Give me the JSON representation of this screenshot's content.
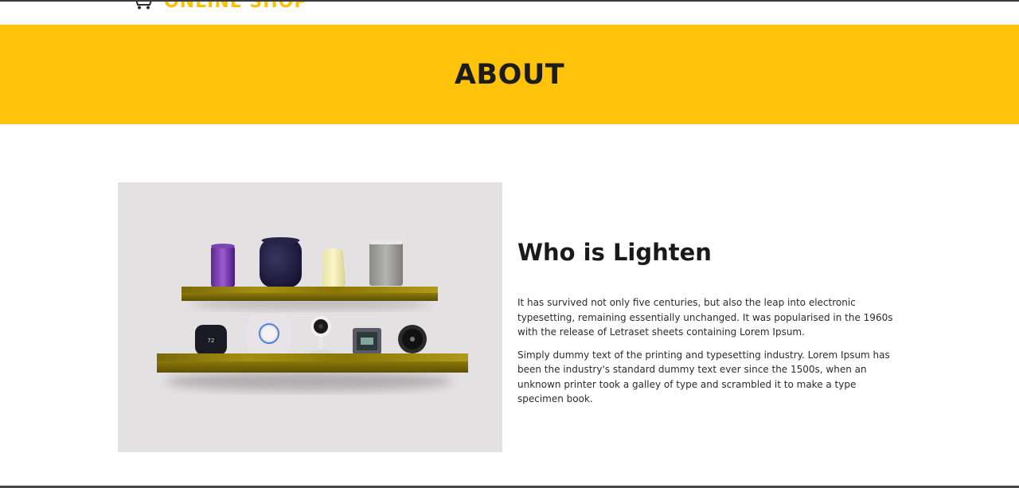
{
  "header": {
    "brand_name": "ONLINE SHOP",
    "brand_icon": "cart-icon"
  },
  "banner": {
    "title": "ABOUT"
  },
  "about": {
    "image_alt": "smart home devices on wooden shelves",
    "heading": "Who is Lighten",
    "paragraphs": [
      "It has survived not only five centuries, but also the leap into electronic typesetting, remaining essentially unchanged. It was popularised in the 1960s with the release of Letraset sheets containing Lorem Ipsum.",
      "Simply dummy text of the printing and typesetting industry. Lorem Ipsum has been the industry's standard dummy text ever since the 1500s, when an unknown printer took a galley of type and scrambled it to make a type specimen book."
    ],
    "thermostat_reading": "72"
  },
  "colors": {
    "accent": "#fec30a",
    "text_dark": "#1c1c1c"
  }
}
